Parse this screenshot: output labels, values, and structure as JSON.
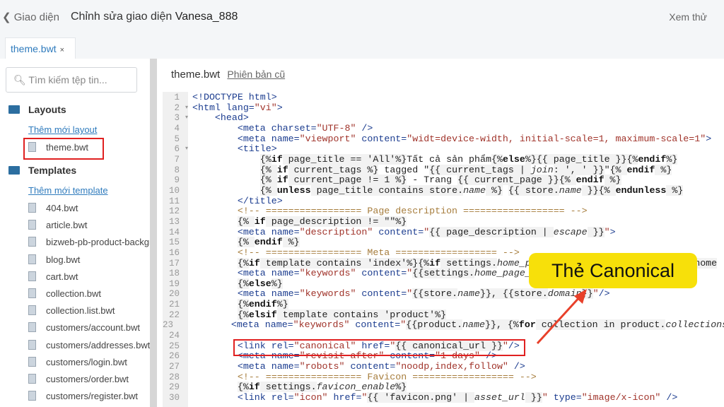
{
  "header": {
    "back_label": "Giao diện",
    "title_prefix": "Chỉnh sửa giao diện",
    "theme_name": "Vanesa_888",
    "preview_label": "Xem thử"
  },
  "tab": {
    "label": "theme.bwt",
    "close": "×"
  },
  "sidebar": {
    "search_placeholder": "Tìm kiếm tệp tin...",
    "layouts": {
      "label": "Layouts",
      "add_label": "Thêm mới layout",
      "files": [
        "theme.bwt"
      ]
    },
    "templates": {
      "label": "Templates",
      "add_label": "Thêm mới template",
      "files": [
        "404.bwt",
        "article.bwt",
        "bizweb-pb-product-background.bwt",
        "blog.bwt",
        "cart.bwt",
        "collection.bwt",
        "collection.list.bwt",
        "customers/account.bwt",
        "customers/addresses.bwt",
        "customers/login.bwt",
        "customers/order.bwt",
        "customers/register.bwt"
      ]
    }
  },
  "editor": {
    "filename": "theme.bwt",
    "old_version_label": "Phiên bản cũ",
    "lines": [
      [
        [
          "tag",
          "<!DOCTYPE html>"
        ]
      ],
      [
        [
          "tag",
          "<html "
        ],
        [
          "attr",
          "lang="
        ],
        [
          "str",
          "\"vi\""
        ],
        [
          "tag",
          ">"
        ]
      ],
      [
        [
          "pl",
          "    "
        ],
        [
          "tag",
          "<head>"
        ]
      ],
      [
        [
          "pl",
          "        "
        ],
        [
          "tag",
          "<meta "
        ],
        [
          "attr",
          "charset="
        ],
        [
          "str",
          "\"UTF-8\""
        ],
        [
          "tag",
          " />"
        ]
      ],
      [
        [
          "pl",
          "        "
        ],
        [
          "tag",
          "<meta "
        ],
        [
          "attr",
          "name="
        ],
        [
          "str",
          "\"viewport\""
        ],
        [
          "attr",
          " content="
        ],
        [
          "str",
          "\"widt=device-width, initial-scale=1, maximum-scale=1\""
        ],
        [
          "tag",
          ">"
        ]
      ],
      [
        [
          "pl",
          "        "
        ],
        [
          "tag",
          "<title>"
        ]
      ],
      [
        [
          "pl",
          "            "
        ],
        [
          "lq",
          "{%"
        ],
        [
          "kw",
          "if"
        ],
        [
          "lq",
          " page_title == 'All'%}"
        ],
        [
          "pl",
          "Tất cả sản phẩm"
        ],
        [
          "lq",
          "{%"
        ],
        [
          "kw",
          "else"
        ],
        [
          "lq",
          "%}{{ page_title }}{%"
        ],
        [
          "kw",
          "endif"
        ],
        [
          "lq",
          "%}"
        ]
      ],
      [
        [
          "pl",
          "            "
        ],
        [
          "lq",
          "{% "
        ],
        [
          "kw",
          "if"
        ],
        [
          "lq",
          " current_tags %}"
        ],
        [
          "pl",
          " tagged \""
        ],
        [
          "lq",
          "{{ current_tags | "
        ],
        [
          "it",
          "join"
        ],
        [
          "lq",
          ": ', ' }}"
        ],
        [
          "pl",
          "\""
        ],
        [
          "lq",
          "{% "
        ],
        [
          "kw",
          "endif"
        ],
        [
          "lq",
          " %}"
        ]
      ],
      [
        [
          "pl",
          "            "
        ],
        [
          "lq",
          "{% "
        ],
        [
          "kw",
          "if"
        ],
        [
          "lq",
          " current_page != 1 %}"
        ],
        [
          "pl",
          " - Trang "
        ],
        [
          "lq",
          "{{ current_page }}{% "
        ],
        [
          "kw",
          "endif"
        ],
        [
          "lq",
          " %}"
        ]
      ],
      [
        [
          "pl",
          "            "
        ],
        [
          "lq",
          "{% "
        ],
        [
          "kw",
          "unless"
        ],
        [
          "lq",
          " page_title contains store."
        ],
        [
          "it",
          "name"
        ],
        [
          "lq",
          " %}"
        ],
        [
          "pl",
          " "
        ],
        [
          "lq",
          "{{ store."
        ],
        [
          "it",
          "name"
        ],
        [
          "lq",
          " }}{% "
        ],
        [
          "kw",
          "endunless"
        ],
        [
          "lq",
          " %}"
        ]
      ],
      [
        [
          "pl",
          "        "
        ],
        [
          "tag",
          "</title>"
        ]
      ],
      [
        [
          "pl",
          "        "
        ],
        [
          "cm",
          "<!-- ================= Page description ================== -->"
        ]
      ],
      [
        [
          "pl",
          "        "
        ],
        [
          "lq",
          "{% "
        ],
        [
          "kw",
          "if"
        ],
        [
          "lq",
          " page_description != \"\"%}"
        ]
      ],
      [
        [
          "pl",
          "        "
        ],
        [
          "tag",
          "<meta "
        ],
        [
          "attr",
          "name="
        ],
        [
          "str",
          "\"description\""
        ],
        [
          "attr",
          " content="
        ],
        [
          "str",
          "\""
        ],
        [
          "lq",
          "{{ page_description | "
        ],
        [
          "it",
          "escape"
        ],
        [
          "lq",
          " }}"
        ],
        [
          "str",
          "\""
        ],
        [
          "tag",
          ">"
        ]
      ],
      [
        [
          "pl",
          "        "
        ],
        [
          "lq",
          "{% "
        ],
        [
          "kw",
          "endif"
        ],
        [
          "lq",
          " %}"
        ]
      ],
      [
        [
          "pl",
          "        "
        ],
        [
          "cm",
          "<!-- ================= Meta ================== -->"
        ]
      ],
      [
        [
          "pl",
          "        "
        ],
        [
          "lq",
          "{%"
        ],
        [
          "kw",
          "if"
        ],
        [
          "lq",
          " template contains 'index'%}{%"
        ],
        [
          "kw",
          "if"
        ],
        [
          "lq",
          " settings."
        ],
        [
          "it",
          "home_page_description"
        ],
        [
          "lq",
          " %}{{settings.home"
        ]
      ],
      [
        [
          "pl",
          "        "
        ],
        [
          "tag",
          "<meta "
        ],
        [
          "attr",
          "name="
        ],
        [
          "str",
          "\"keywords\""
        ],
        [
          "attr",
          " content="
        ],
        [
          "str",
          "\""
        ],
        [
          "lq",
          "{{settings."
        ],
        [
          "it",
          "home_page_keywords"
        ],
        [
          "lq",
          "}}"
        ]
      ],
      [
        [
          "pl",
          "        "
        ],
        [
          "lq",
          "{%"
        ],
        [
          "kw",
          "else"
        ],
        [
          "lq",
          "%}"
        ]
      ],
      [
        [
          "pl",
          "        "
        ],
        [
          "tag",
          "<meta "
        ],
        [
          "attr",
          "name="
        ],
        [
          "str",
          "\"keywords\""
        ],
        [
          "attr",
          " content="
        ],
        [
          "str",
          "\""
        ],
        [
          "lq",
          "{{store."
        ],
        [
          "it",
          "name"
        ],
        [
          "lq",
          "}}, {{store."
        ],
        [
          "it",
          "domain"
        ],
        [
          "lq",
          "}}"
        ],
        [
          "str",
          "\""
        ],
        [
          "tag",
          "/>"
        ]
      ],
      [
        [
          "pl",
          "        "
        ],
        [
          "lq",
          "{%"
        ],
        [
          "kw",
          "endif"
        ],
        [
          "lq",
          "%}"
        ]
      ],
      [
        [
          "pl",
          "        "
        ],
        [
          "lq",
          "{%"
        ],
        [
          "kw",
          "elsif"
        ],
        [
          "lq",
          " template contains 'product'%}"
        ]
      ],
      [
        [
          "pl",
          "        "
        ],
        [
          "tag",
          "<meta "
        ],
        [
          "attr",
          "name="
        ],
        [
          "str",
          "\"keywords\""
        ],
        [
          "attr",
          " content="
        ],
        [
          "str",
          "\""
        ],
        [
          "lq",
          "{{product."
        ],
        [
          "it",
          "name"
        ],
        [
          "lq",
          "}}, {%"
        ],
        [
          "kw",
          "for"
        ],
        [
          "lq",
          " collection in product."
        ],
        [
          "it",
          "collections"
        ]
      ],
      [],
      [
        [
          "pl",
          "        "
        ],
        [
          "tag",
          "<link "
        ],
        [
          "attr",
          "rel="
        ],
        [
          "str",
          "\"canonical\""
        ],
        [
          "attr",
          " href="
        ],
        [
          "str",
          "\""
        ],
        [
          "lq",
          "{{ canonical_url }}"
        ],
        [
          "str",
          "\""
        ],
        [
          "tag",
          "/>"
        ]
      ],
      [
        [
          "pl",
          "        "
        ],
        [
          "tag",
          "<meta "
        ],
        [
          "attr",
          "name="
        ],
        [
          "str",
          "\"revisit-after\""
        ],
        [
          "attr",
          " content="
        ],
        [
          "str",
          "\"1 days\""
        ],
        [
          "tag",
          " />"
        ]
      ],
      [
        [
          "pl",
          "        "
        ],
        [
          "tag",
          "<meta "
        ],
        [
          "attr",
          "name="
        ],
        [
          "str",
          "\"robots\""
        ],
        [
          "attr",
          " content="
        ],
        [
          "str",
          "\"noodp,index,follow\""
        ],
        [
          "tag",
          " />"
        ]
      ],
      [
        [
          "pl",
          "        "
        ],
        [
          "cm",
          "<!-- ================= Favicon ================== -->"
        ]
      ],
      [
        [
          "pl",
          "        "
        ],
        [
          "lq",
          "{%"
        ],
        [
          "kw",
          "if"
        ],
        [
          "lq",
          " settings."
        ],
        [
          "it",
          "favicon_enable"
        ],
        [
          "lq",
          "%}"
        ]
      ],
      [
        [
          "pl",
          "        "
        ],
        [
          "tag",
          "<link "
        ],
        [
          "attr",
          "rel="
        ],
        [
          "str",
          "\"icon\""
        ],
        [
          "attr",
          " href="
        ],
        [
          "str",
          "\""
        ],
        [
          "lq",
          "{{ 'favicon.png' | "
        ],
        [
          "it",
          "asset_url"
        ],
        [
          "lq",
          " }}"
        ],
        [
          "str",
          "\""
        ],
        [
          "attr",
          " type="
        ],
        [
          "str",
          "\"image/x-icon\""
        ],
        [
          "tag",
          " />"
        ]
      ]
    ],
    "folded_lines": [
      2,
      3,
      6
    ]
  },
  "annotation": {
    "callout_text": "Thẻ Canonical",
    "highlight_color": "#e02020",
    "callout_color": "#f7e00a"
  }
}
